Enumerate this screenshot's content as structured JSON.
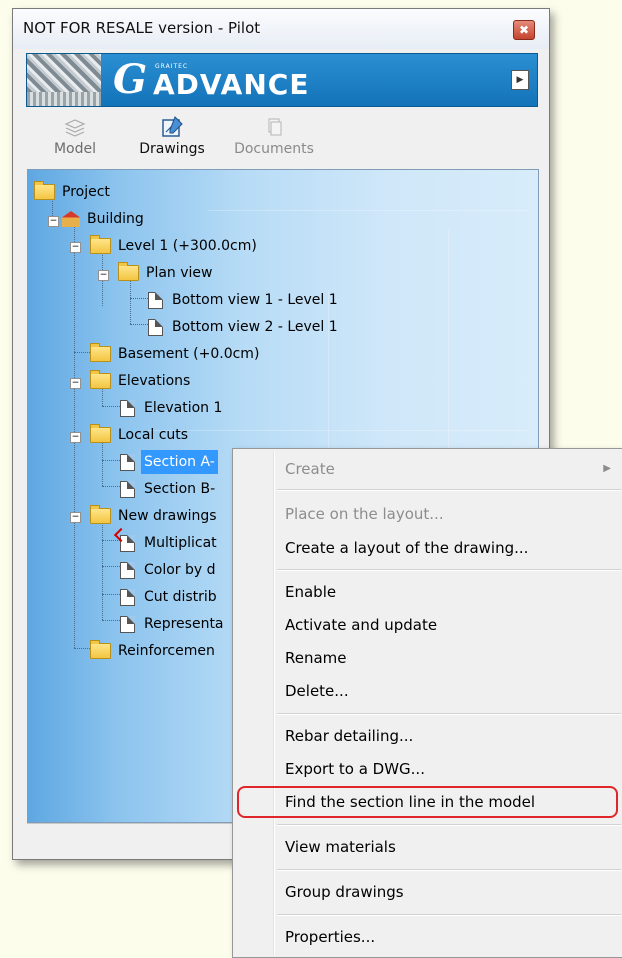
{
  "window": {
    "title": "NOT FOR RESALE version - Pilot",
    "close_glyph": "✖"
  },
  "banner": {
    "brand_small": "GRAITEC",
    "brand_g": "G",
    "brand_text": "ADVANCE",
    "arrow_glyph": "▶"
  },
  "tabs": [
    {
      "label": "Model",
      "icon": "layers-icon",
      "state": "inactive"
    },
    {
      "label": "Drawings",
      "icon": "drawing-icon",
      "state": "active"
    },
    {
      "label": "Documents",
      "icon": "documents-icon",
      "state": "disabled"
    }
  ],
  "tree": {
    "project": "Project",
    "building": "Building",
    "level1": "Level 1 (+300.0cm)",
    "plan_view": "Plan view",
    "bottom_view_1": "Bottom view 1 - Level 1",
    "bottom_view_2": "Bottom view 2 - Level 1",
    "basement": "Basement (+0.0cm)",
    "elevations": "Elevations",
    "elevation_1": "Elevation 1",
    "local_cuts": "Local cuts",
    "section_a": "Section A-",
    "section_b": "Section B-",
    "new_drawings": "New drawings",
    "multiplicat": "Multiplicat",
    "color_by": "Color by d",
    "cut_distrib": "Cut distrib",
    "representa": "Representa",
    "reinforcement": "Reinforcemen",
    "expander_minus": "−"
  },
  "context_menu": {
    "create": "Create",
    "submenu_arrow": "▶",
    "place_on_layout": "Place on the layout...",
    "create_layout": "Create a layout of the drawing...",
    "enable": "Enable",
    "activate_update": "Activate and update",
    "rename": "Rename",
    "delete": "Delete...",
    "rebar_detailing": "Rebar detailing...",
    "export_dwg": "Export to a DWG...",
    "find_section": "Find the section line in the model",
    "view_materials": "View materials",
    "group_drawings": "Group drawings",
    "properties": "Properties..."
  },
  "colors": {
    "selection": "#3399ff",
    "highlight_outline": "#e0262b",
    "banner": "#1e82c8"
  }
}
